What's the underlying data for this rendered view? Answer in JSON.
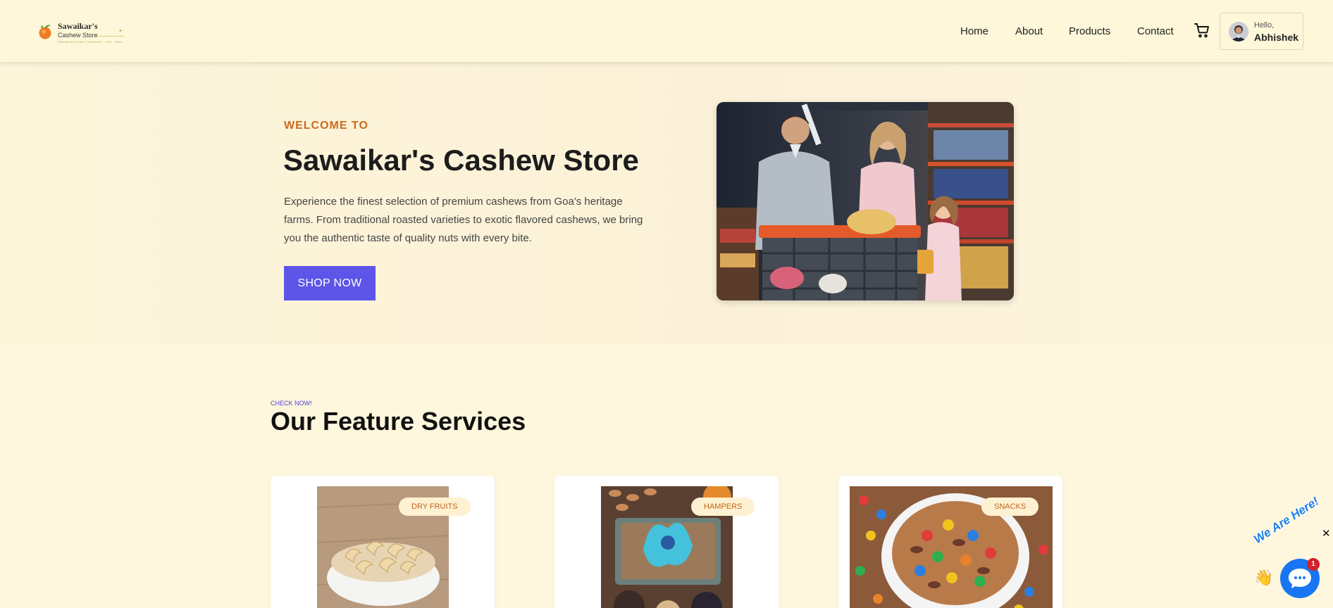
{
  "header": {
    "logo": {
      "name": "Sawaikar's",
      "subtitle": "Cashew Store",
      "tagline": "PREMIUM GOAN CASHEWS · EST. 1995"
    },
    "nav": [
      {
        "label": "Home"
      },
      {
        "label": "About"
      },
      {
        "label": "Products"
      },
      {
        "label": "Contact"
      }
    ],
    "cart_icon": "shopping-cart-icon",
    "user": {
      "greeting": "Hello,",
      "name": "Abhishek"
    }
  },
  "hero": {
    "eyebrow": "WELCOME TO",
    "title": "Sawaikar's Cashew Store",
    "description": "Experience the finest selection of premium cashews from Goa's heritage farms. From traditional roasted varieties to exotic flavored cashews, we bring you the authentic taste of quality nuts with every bite.",
    "cta_label": "SHOP NOW",
    "cta_color": "#5c55e8",
    "eyebrow_color": "#cc6a1c"
  },
  "features": {
    "eyebrow": "CHECK NOW!",
    "title": "Our Feature Services",
    "cards": [
      {
        "badge": "DRY FRUITS"
      },
      {
        "badge": "HAMPERS"
      },
      {
        "badge": "SNACKS"
      }
    ]
  },
  "chat_widget": {
    "caption": "We Are Here!",
    "unread_count": "1",
    "close_symbol": "✕",
    "icon": "chat-bubble-icon"
  }
}
